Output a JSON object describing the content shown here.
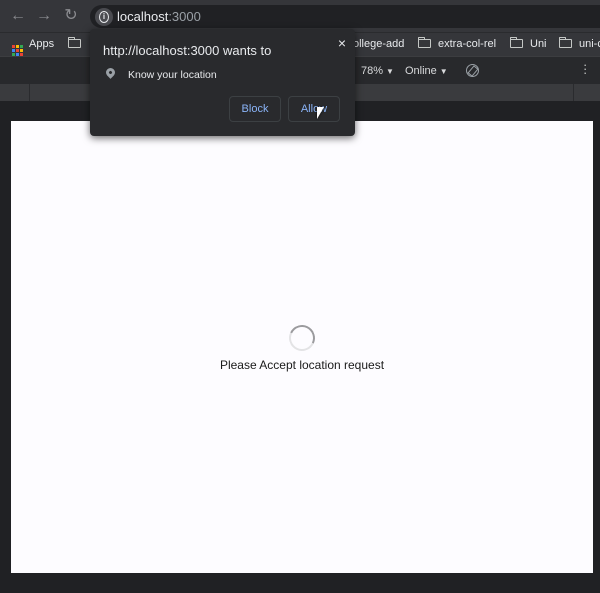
{
  "nav": {
    "back_icon": "←",
    "forward_icon": "→",
    "reload_icon": "↻",
    "url_host": "localhost",
    "url_port": ":3000"
  },
  "bookmarks": {
    "apps_label": "Apps",
    "items": [
      {
        "label": "ollege-add"
      },
      {
        "label": "extra-col-rel"
      },
      {
        "label": "Uni"
      },
      {
        "label": "uni-c"
      }
    ]
  },
  "devtools": {
    "zoom": "78%",
    "network": "Online"
  },
  "popup": {
    "title": "http://localhost:3000 wants to",
    "close_label": "×",
    "permission": "Know your location",
    "block_label": "Block",
    "allow_label": "Allow"
  },
  "page": {
    "status_text": "Please Accept location request"
  },
  "colors": {
    "accent_link": "#8ab4f8",
    "chrome_dark": "#35363a"
  }
}
